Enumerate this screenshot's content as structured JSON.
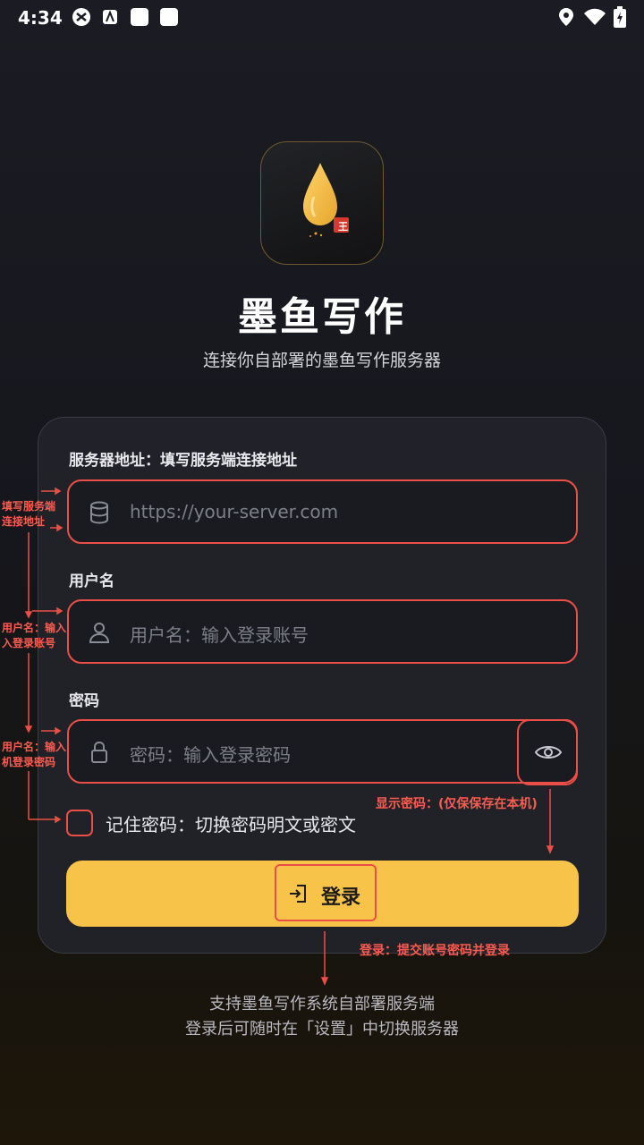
{
  "status_bar": {
    "time": "4:34",
    "icons": [
      "shield-app-icon",
      "app-a-icon",
      "square-notification-icon",
      "square-notification-icon",
      "location-icon",
      "wifi-icon",
      "battery-charging-icon"
    ]
  },
  "app": {
    "title": "墨鱼写作",
    "subtitle": "连接你自部署的墨鱼写作服务器",
    "logo_badge": "王"
  },
  "form": {
    "server": {
      "label": "服务器地址：填写服务端连接地址",
      "placeholder": "https://your-server.com"
    },
    "username": {
      "label": "用户名",
      "placeholder": "用户名：输入登录账号"
    },
    "password": {
      "label": "密码",
      "placeholder": "密码：输入登录密码"
    },
    "remember": {
      "label": "记住密码：切换密码明文或密文",
      "checked": false
    },
    "login_button": "登录"
  },
  "footer": {
    "line1": "支持墨鱼写作系统自部署服务端",
    "line2": "登录后可随时在「设置」中切换服务器"
  },
  "annotations": {
    "server_l1": "填写服务端",
    "server_l2": "连接地址",
    "user_l1": "用户名：输入",
    "user_l2": "入登录账号",
    "pwd_l1": "用户名：输入",
    "pwd_l2": "机登录密码",
    "show_password": "显示密码：(仅保保存在本机)",
    "login": "登录：提交账号密码并登录"
  },
  "colors": {
    "accent": "#f8c349",
    "annotation": "#ea4f47"
  }
}
